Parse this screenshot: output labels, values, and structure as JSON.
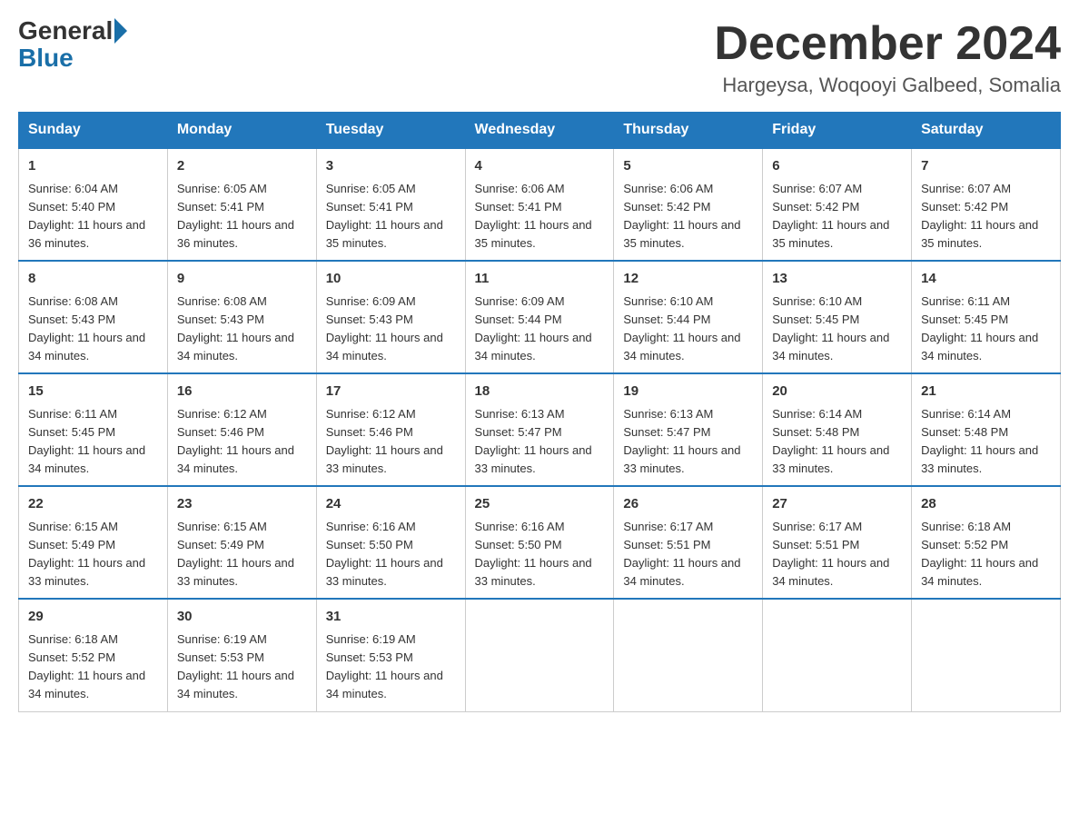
{
  "header": {
    "logo_general": "General",
    "logo_blue": "Blue",
    "month_title": "December 2024",
    "location": "Hargeysa, Woqooyi Galbeed, Somalia"
  },
  "days_of_week": [
    "Sunday",
    "Monday",
    "Tuesday",
    "Wednesday",
    "Thursday",
    "Friday",
    "Saturday"
  ],
  "weeks": [
    [
      {
        "day": "1",
        "sunrise": "6:04 AM",
        "sunset": "5:40 PM",
        "daylight": "11 hours and 36 minutes."
      },
      {
        "day": "2",
        "sunrise": "6:05 AM",
        "sunset": "5:41 PM",
        "daylight": "11 hours and 36 minutes."
      },
      {
        "day": "3",
        "sunrise": "6:05 AM",
        "sunset": "5:41 PM",
        "daylight": "11 hours and 35 minutes."
      },
      {
        "day": "4",
        "sunrise": "6:06 AM",
        "sunset": "5:41 PM",
        "daylight": "11 hours and 35 minutes."
      },
      {
        "day": "5",
        "sunrise": "6:06 AM",
        "sunset": "5:42 PM",
        "daylight": "11 hours and 35 minutes."
      },
      {
        "day": "6",
        "sunrise": "6:07 AM",
        "sunset": "5:42 PM",
        "daylight": "11 hours and 35 minutes."
      },
      {
        "day": "7",
        "sunrise": "6:07 AM",
        "sunset": "5:42 PM",
        "daylight": "11 hours and 35 minutes."
      }
    ],
    [
      {
        "day": "8",
        "sunrise": "6:08 AM",
        "sunset": "5:43 PM",
        "daylight": "11 hours and 34 minutes."
      },
      {
        "day": "9",
        "sunrise": "6:08 AM",
        "sunset": "5:43 PM",
        "daylight": "11 hours and 34 minutes."
      },
      {
        "day": "10",
        "sunrise": "6:09 AM",
        "sunset": "5:43 PM",
        "daylight": "11 hours and 34 minutes."
      },
      {
        "day": "11",
        "sunrise": "6:09 AM",
        "sunset": "5:44 PM",
        "daylight": "11 hours and 34 minutes."
      },
      {
        "day": "12",
        "sunrise": "6:10 AM",
        "sunset": "5:44 PM",
        "daylight": "11 hours and 34 minutes."
      },
      {
        "day": "13",
        "sunrise": "6:10 AM",
        "sunset": "5:45 PM",
        "daylight": "11 hours and 34 minutes."
      },
      {
        "day": "14",
        "sunrise": "6:11 AM",
        "sunset": "5:45 PM",
        "daylight": "11 hours and 34 minutes."
      }
    ],
    [
      {
        "day": "15",
        "sunrise": "6:11 AM",
        "sunset": "5:45 PM",
        "daylight": "11 hours and 34 minutes."
      },
      {
        "day": "16",
        "sunrise": "6:12 AM",
        "sunset": "5:46 PM",
        "daylight": "11 hours and 34 minutes."
      },
      {
        "day": "17",
        "sunrise": "6:12 AM",
        "sunset": "5:46 PM",
        "daylight": "11 hours and 33 minutes."
      },
      {
        "day": "18",
        "sunrise": "6:13 AM",
        "sunset": "5:47 PM",
        "daylight": "11 hours and 33 minutes."
      },
      {
        "day": "19",
        "sunrise": "6:13 AM",
        "sunset": "5:47 PM",
        "daylight": "11 hours and 33 minutes."
      },
      {
        "day": "20",
        "sunrise": "6:14 AM",
        "sunset": "5:48 PM",
        "daylight": "11 hours and 33 minutes."
      },
      {
        "day": "21",
        "sunrise": "6:14 AM",
        "sunset": "5:48 PM",
        "daylight": "11 hours and 33 minutes."
      }
    ],
    [
      {
        "day": "22",
        "sunrise": "6:15 AM",
        "sunset": "5:49 PM",
        "daylight": "11 hours and 33 minutes."
      },
      {
        "day": "23",
        "sunrise": "6:15 AM",
        "sunset": "5:49 PM",
        "daylight": "11 hours and 33 minutes."
      },
      {
        "day": "24",
        "sunrise": "6:16 AM",
        "sunset": "5:50 PM",
        "daylight": "11 hours and 33 minutes."
      },
      {
        "day": "25",
        "sunrise": "6:16 AM",
        "sunset": "5:50 PM",
        "daylight": "11 hours and 33 minutes."
      },
      {
        "day": "26",
        "sunrise": "6:17 AM",
        "sunset": "5:51 PM",
        "daylight": "11 hours and 34 minutes."
      },
      {
        "day": "27",
        "sunrise": "6:17 AM",
        "sunset": "5:51 PM",
        "daylight": "11 hours and 34 minutes."
      },
      {
        "day": "28",
        "sunrise": "6:18 AM",
        "sunset": "5:52 PM",
        "daylight": "11 hours and 34 minutes."
      }
    ],
    [
      {
        "day": "29",
        "sunrise": "6:18 AM",
        "sunset": "5:52 PM",
        "daylight": "11 hours and 34 minutes."
      },
      {
        "day": "30",
        "sunrise": "6:19 AM",
        "sunset": "5:53 PM",
        "daylight": "11 hours and 34 minutes."
      },
      {
        "day": "31",
        "sunrise": "6:19 AM",
        "sunset": "5:53 PM",
        "daylight": "11 hours and 34 minutes."
      },
      null,
      null,
      null,
      null
    ]
  ]
}
